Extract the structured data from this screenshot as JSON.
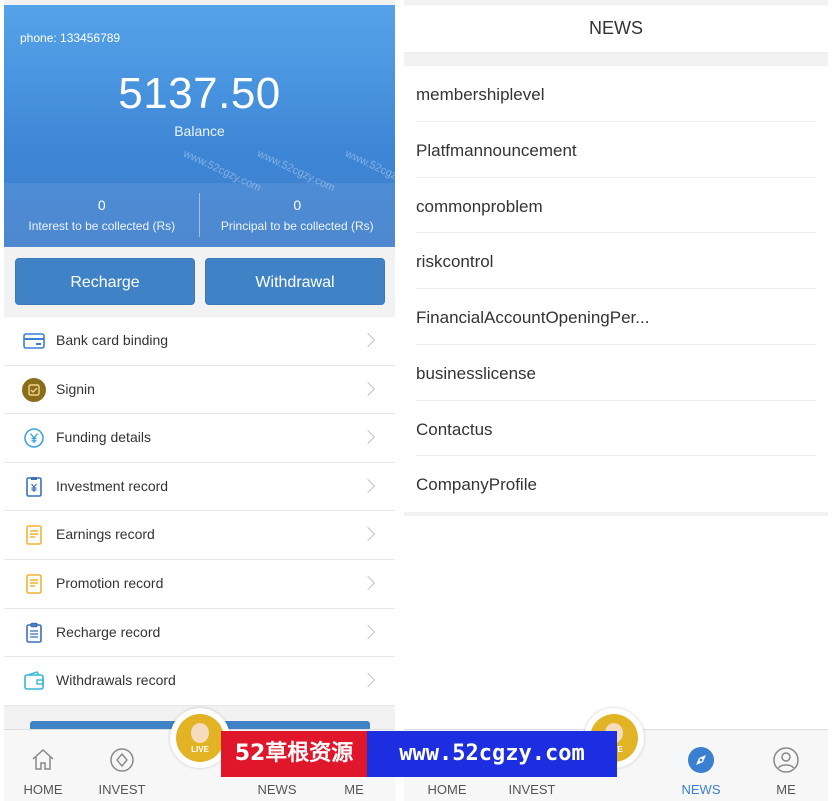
{
  "account": {
    "phone_text": "phone: 133456789",
    "balance": "5137.50",
    "balance_label": "Balance",
    "interest_value": "0",
    "interest_label": "Interest to be collected (Rs)",
    "principal_value": "0",
    "principal_label": "Principal to be collected (Rs)"
  },
  "actions": {
    "recharge": "Recharge",
    "withdrawal": "Withdrawal"
  },
  "menu": [
    {
      "label": "Bank card binding",
      "icon": "bank-card-icon"
    },
    {
      "label": "Signin",
      "icon": "signin-icon"
    },
    {
      "label": "Funding details",
      "icon": "yen-circle-icon"
    },
    {
      "label": "Investment record",
      "icon": "investment-doc-icon"
    },
    {
      "label": "Earnings record",
      "icon": "earnings-doc-icon"
    },
    {
      "label": "Promotion record",
      "icon": "promotion-doc-icon"
    },
    {
      "label": "Recharge record",
      "icon": "clipboard-icon"
    },
    {
      "label": "Withdrawals record",
      "icon": "wallet-icon"
    }
  ],
  "left_tabs": {
    "home": "HOME",
    "invest": "INVEST",
    "news": "NEWS",
    "me": "ME"
  },
  "news": {
    "title": "NEWS",
    "items": [
      "membershiplevel",
      "Platfmannouncement",
      "commonproblem",
      "riskcontrol",
      "FinancialAccountOpeningPer...",
      "businesslicense",
      "Contactus",
      "CompanyProfile"
    ]
  },
  "right_tabs": {
    "home": "HOME",
    "invest": "INVEST",
    "news": "NEWS",
    "me": "ME"
  },
  "live_badge": "LIVE",
  "watermark": {
    "left": "52草根资源",
    "right": "www.52cgzy.com",
    "diagonal": "www.52cgzy.com"
  },
  "colors": {
    "header_top": "#56a3e9",
    "header_bottom": "#3f7ecb",
    "button": "#3f83c6",
    "active_tab": "#3b7fd0",
    "banner_red": "#e0162b",
    "banner_blue": "#1c2ee0"
  }
}
